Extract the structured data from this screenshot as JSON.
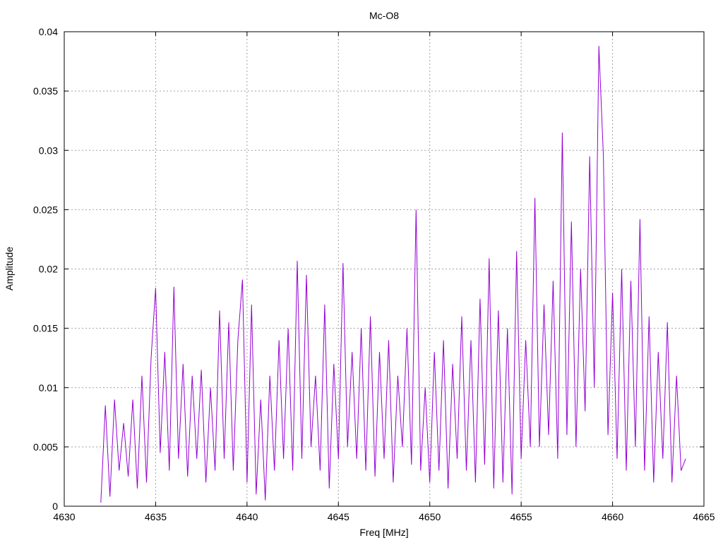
{
  "chart_data": {
    "type": "line",
    "title": "Mc-O8",
    "xlabel": "Freq [MHz]",
    "ylabel": "Amplitude",
    "xlim": [
      4630,
      4665
    ],
    "ylim": [
      0,
      0.04
    ],
    "xticks": [
      "4630",
      "4635",
      "4640",
      "4645",
      "4650",
      "4655",
      "4660",
      "4665"
    ],
    "xtick_values": [
      4630,
      4635,
      4640,
      4645,
      4650,
      4655,
      4660,
      4665
    ],
    "yticks": [
      "0",
      "0.005",
      "0.01",
      "0.015",
      "0.02",
      "0.025",
      "0.03",
      "0.035",
      "0.04"
    ],
    "ytick_values": [
      0,
      0.005,
      0.01,
      0.015,
      0.02,
      0.025,
      0.03,
      0.035,
      0.04
    ],
    "grid": true,
    "series_color": "#9400d3",
    "x_start": 4632,
    "x_step": 0.25,
    "values": [
      0.0003,
      0.0085,
      0.0008,
      0.009,
      0.003,
      0.007,
      0.0025,
      0.009,
      0.0015,
      0.011,
      0.002,
      0.0125,
      0.0184,
      0.0045,
      0.013,
      0.003,
      0.0185,
      0.004,
      0.012,
      0.0025,
      0.011,
      0.004,
      0.0115,
      0.002,
      0.01,
      0.003,
      0.0165,
      0.004,
      0.0155,
      0.003,
      0.014,
      0.0191,
      0.002,
      0.017,
      0.001,
      0.009,
      0.0005,
      0.011,
      0.003,
      0.014,
      0.004,
      0.015,
      0.003,
      0.0207,
      0.004,
      0.0195,
      0.005,
      0.011,
      0.003,
      0.017,
      0.0015,
      0.012,
      0.004,
      0.0205,
      0.005,
      0.013,
      0.004,
      0.015,
      0.003,
      0.016,
      0.0025,
      0.013,
      0.004,
      0.014,
      0.002,
      0.011,
      0.005,
      0.015,
      0.0035,
      0.025,
      0.003,
      0.01,
      0.002,
      0.013,
      0.003,
      0.014,
      0.0015,
      0.012,
      0.004,
      0.016,
      0.003,
      0.014,
      0.002,
      0.0175,
      0.0035,
      0.0209,
      0.0015,
      0.0165,
      0.002,
      0.015,
      0.001,
      0.0215,
      0.004,
      0.014,
      0.005,
      0.026,
      0.005,
      0.017,
      0.006,
      0.019,
      0.004,
      0.0315,
      0.006,
      0.024,
      0.005,
      0.02,
      0.008,
      0.0295,
      0.01,
      0.0388,
      0.0295,
      0.006,
      0.018,
      0.004,
      0.02,
      0.003,
      0.019,
      0.005,
      0.0242,
      0.003,
      0.016,
      0.002,
      0.013,
      0.004,
      0.0155,
      0.002,
      0.011,
      0.003,
      0.004
    ]
  }
}
